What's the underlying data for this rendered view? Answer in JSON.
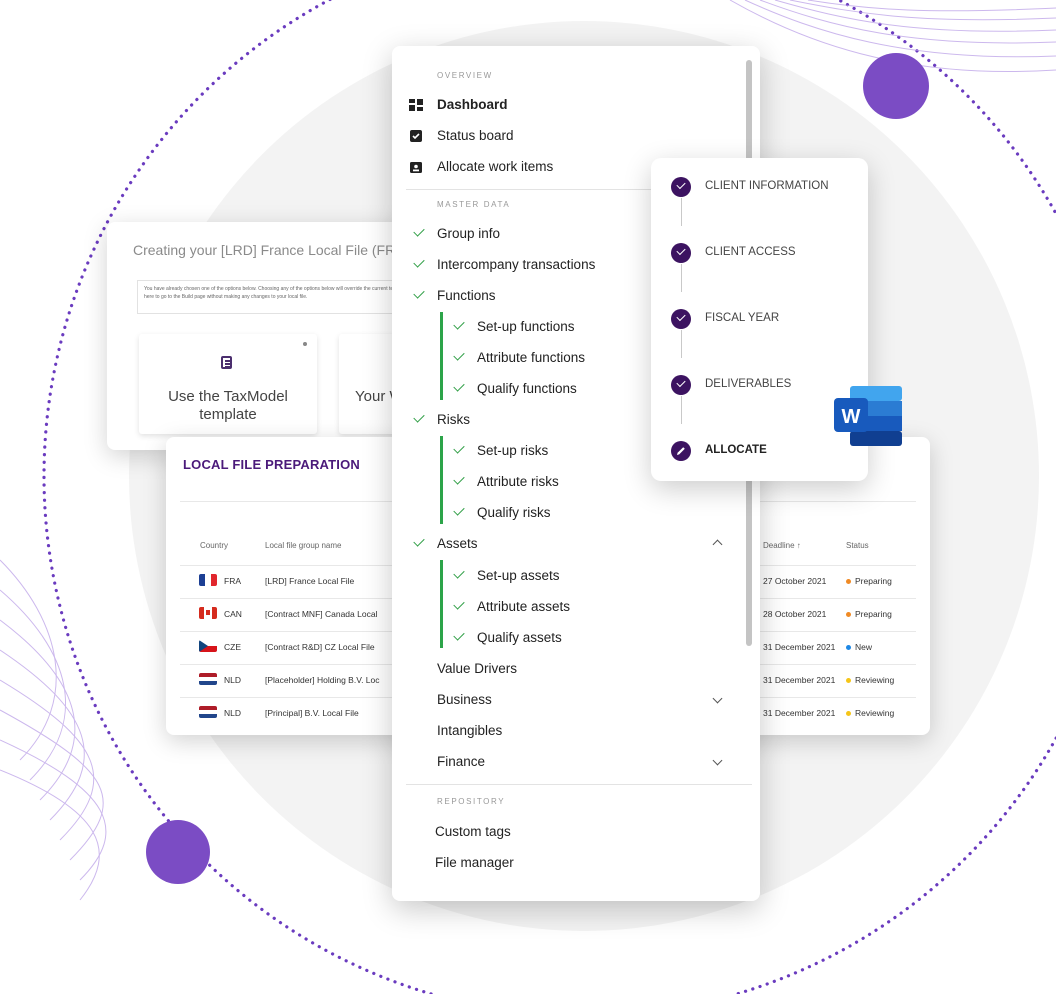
{
  "template_card": {
    "title": "Creating your [LRD] France Local File (FRA)",
    "note": "You have already chosen one of the options below. Choosing any of the options below will override the current template. Click here to go to the Build page without making any changes to your local file.",
    "option_1": "Use the TaxModel template",
    "option_2": "Your W"
  },
  "table_card": {
    "heading": "LOCAL FILE PREPARATION",
    "columns": {
      "country": "Country",
      "group": "Local file group name",
      "deadline": "Deadline ↑",
      "status": "Status"
    },
    "rows": [
      {
        "code": "FRA",
        "group": "[LRD] France Local File",
        "deadline": "27 October 2021",
        "status": "Preparing",
        "status_color": "#f08a24"
      },
      {
        "code": "CAN",
        "group": "[Contract MNF] Canada Local",
        "deadline": "28 October 2021",
        "status": "Preparing",
        "status_color": "#f08a24"
      },
      {
        "code": "CZE",
        "group": "[Contract R&D] CZ Local File",
        "deadline": "31 December 2021",
        "status": "New",
        "status_color": "#1e88e5"
      },
      {
        "code": "NLD",
        "group": "[Placeholder] Holding B.V. Loc",
        "deadline": "31 December 2021",
        "status": "Reviewing",
        "status_color": "#f5c518"
      },
      {
        "code": "NLD",
        "group": "[Principal] B.V. Local File",
        "deadline": "31 December 2021",
        "status": "Reviewing",
        "status_color": "#f5c518"
      }
    ]
  },
  "nav": {
    "overview_label": "OVERVIEW",
    "dashboard": "Dashboard",
    "status_board": "Status board",
    "allocate_work": "Allocate work items",
    "master_data_label": "MASTER DATA",
    "group_info": "Group info",
    "intercompany": "Intercompany transactions",
    "functions": "Functions",
    "setup_functions": "Set-up functions",
    "attribute_functions": "Attribute functions",
    "qualify_functions": "Qualify functions",
    "risks": "Risks",
    "setup_risks": "Set-up risks",
    "attribute_risks": "Attribute risks",
    "qualify_risks": "Qualify risks",
    "assets": "Assets",
    "setup_assets": "Set-up assets",
    "attribute_assets": "Attribute assets",
    "qualify_assets": "Qualify assets",
    "value_drivers": "Value Drivers",
    "business": "Business",
    "intangibles": "Intangibles",
    "finance": "Finance",
    "repository_label": "REPOSITORY",
    "custom_tags": "Custom tags",
    "file_manager": "File manager"
  },
  "steps": {
    "items": [
      "CLIENT INFORMATION",
      "CLIENT ACCESS",
      "FISCAL YEAR",
      "DELIVERABLES",
      "ALLOCATE"
    ],
    "completed_count": 4,
    "current_index": 4
  },
  "word_icon": {
    "letter": "W"
  },
  "colors": {
    "accent_purple": "#3c1361",
    "check_green": "#2e9e44",
    "decor_purple": "#7b4cc4"
  }
}
